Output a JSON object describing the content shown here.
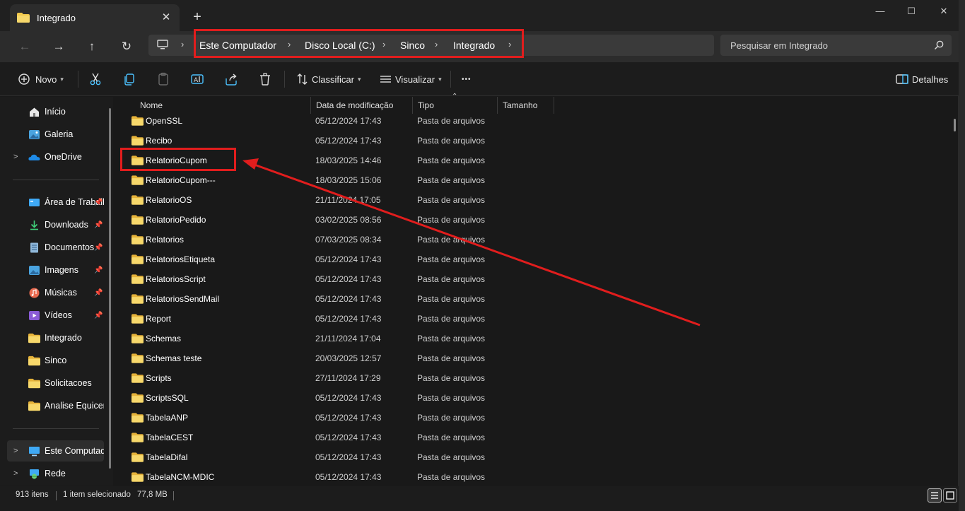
{
  "window": {
    "tab_title": "Integrado",
    "new_tab": "+",
    "close_tab": "✕",
    "minimize": "—",
    "maximize": "☐",
    "close": "✕"
  },
  "nav": {
    "back": "←",
    "forward": "→",
    "up": "↑",
    "refresh": "↻",
    "breadcrumb": [
      "Este Computador",
      "Disco Local (C:)",
      "Sinco",
      "Integrado"
    ],
    "chevron": "›",
    "search_placeholder": "Pesquisar em Integrado"
  },
  "commands": {
    "novo": "Novo",
    "classificar": "Classificar",
    "visualizar": "Visualizar",
    "more": "•••",
    "detalhes": "Detalhes"
  },
  "sidebar": {
    "top": [
      {
        "label": "Início",
        "icon": "home-icon"
      },
      {
        "label": "Galeria",
        "icon": "gallery-icon"
      },
      {
        "label": "OneDrive",
        "icon": "onedrive-icon",
        "expandable": true
      }
    ],
    "pinned": [
      {
        "label": "Área de Trabalho",
        "icon": "desktop-icon",
        "pinned": true
      },
      {
        "label": "Downloads",
        "icon": "download-icon",
        "pinned": true
      },
      {
        "label": "Documentos",
        "icon": "documents-icon",
        "pinned": true
      },
      {
        "label": "Imagens",
        "icon": "pictures-icon",
        "pinned": true
      },
      {
        "label": "Músicas",
        "icon": "music-icon",
        "pinned": true
      },
      {
        "label": "Vídeos",
        "icon": "videos-icon",
        "pinned": true
      },
      {
        "label": "Integrado",
        "icon": "folder-icon"
      },
      {
        "label": "Sinco",
        "icon": "folder-icon"
      },
      {
        "label": "Solicitacoes",
        "icon": "folder-icon"
      },
      {
        "label": "Analise Equicenter",
        "icon": "folder-icon"
      }
    ],
    "bottom": [
      {
        "label": "Este Computador",
        "icon": "computer-icon",
        "expandable": true,
        "selected": true
      },
      {
        "label": "Rede",
        "icon": "network-icon",
        "expandable": true
      }
    ]
  },
  "columns": {
    "name": "Nome",
    "modified": "Data de modificação",
    "type": "Tipo",
    "size": "Tamanho"
  },
  "files": [
    {
      "name": "OpenSSL",
      "date": "05/12/2024 17:43",
      "type": "Pasta de arquivos"
    },
    {
      "name": "Recibo",
      "date": "05/12/2024 17:43",
      "type": "Pasta de arquivos"
    },
    {
      "name": "RelatorioCupom",
      "date": "18/03/2025 14:46",
      "type": "Pasta de arquivos"
    },
    {
      "name": "RelatorioCupom---",
      "date": "18/03/2025 15:06",
      "type": "Pasta de arquivos"
    },
    {
      "name": "RelatorioOS",
      "date": "21/11/2024 17:05",
      "type": "Pasta de arquivos"
    },
    {
      "name": "RelatorioPedido",
      "date": "03/02/2025 08:56",
      "type": "Pasta de arquivos"
    },
    {
      "name": "Relatorios",
      "date": "07/03/2025 08:34",
      "type": "Pasta de arquivos"
    },
    {
      "name": "RelatoriosEtiqueta",
      "date": "05/12/2024 17:43",
      "type": "Pasta de arquivos"
    },
    {
      "name": "RelatoriosScript",
      "date": "05/12/2024 17:43",
      "type": "Pasta de arquivos"
    },
    {
      "name": "RelatoriosSendMail",
      "date": "05/12/2024 17:43",
      "type": "Pasta de arquivos"
    },
    {
      "name": "Report",
      "date": "05/12/2024 17:43",
      "type": "Pasta de arquivos"
    },
    {
      "name": "Schemas",
      "date": "21/11/2024 17:04",
      "type": "Pasta de arquivos"
    },
    {
      "name": "Schemas teste",
      "date": "20/03/2025 12:57",
      "type": "Pasta de arquivos"
    },
    {
      "name": "Scripts",
      "date": "27/11/2024 17:29",
      "type": "Pasta de arquivos"
    },
    {
      "name": "ScriptsSQL",
      "date": "05/12/2024 17:43",
      "type": "Pasta de arquivos"
    },
    {
      "name": "TabelaANP",
      "date": "05/12/2024 17:43",
      "type": "Pasta de arquivos"
    },
    {
      "name": "TabelaCEST",
      "date": "05/12/2024 17:43",
      "type": "Pasta de arquivos"
    },
    {
      "name": "TabelaDifal",
      "date": "05/12/2024 17:43",
      "type": "Pasta de arquivos"
    },
    {
      "name": "TabelaNCM-MDIC",
      "date": "05/12/2024 17:43",
      "type": "Pasta de arquivos"
    }
  ],
  "status": {
    "count": "913 itens",
    "selected": "1 item selecionado",
    "size": "77,8 MB"
  },
  "colors": {
    "highlight": "#e11d1d",
    "folder": "#f2c94c",
    "accent": "#4cc2ff"
  }
}
